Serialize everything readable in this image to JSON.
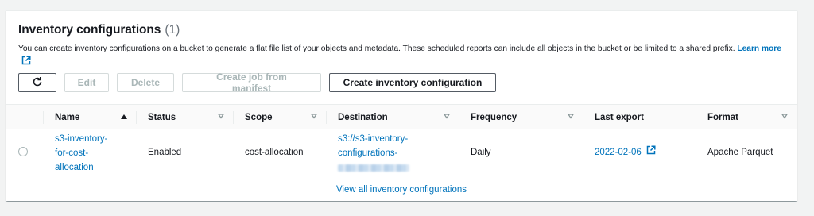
{
  "header": {
    "title": "Inventory configurations",
    "count": "(1)",
    "description": "You can create inventory configurations on a bucket to generate a flat file list of your objects and metadata. These scheduled reports can include all objects in the bucket or be limited to a shared prefix.",
    "learn_more": "Learn more"
  },
  "toolbar": {
    "refresh_icon": "refresh-icon",
    "edit": "Edit",
    "delete": "Delete",
    "create_job": "Create job from manifest",
    "create_config": "Create inventory configuration"
  },
  "table": {
    "columns": [
      "Name",
      "Status",
      "Scope",
      "Destination",
      "Frequency",
      "Last export",
      "Format"
    ],
    "rows": [
      {
        "name": "s3-inventory-for-cost-allocation",
        "name_lines": [
          "s3-inventory-",
          "for-cost-",
          "allocation"
        ],
        "status": "Enabled",
        "scope": "cost-allocation",
        "destination_lines": [
          "s3://s3-inventory-",
          "configurations-"
        ],
        "frequency": "Daily",
        "last_export": "2022-02-06",
        "format": "Apache Parquet"
      }
    ]
  },
  "footer": {
    "view_all": "View all inventory configurations"
  },
  "colors": {
    "link": "#0073bb",
    "border": "#eaeded",
    "disabled": "#aab7b8",
    "background": "#f2f3f3"
  }
}
